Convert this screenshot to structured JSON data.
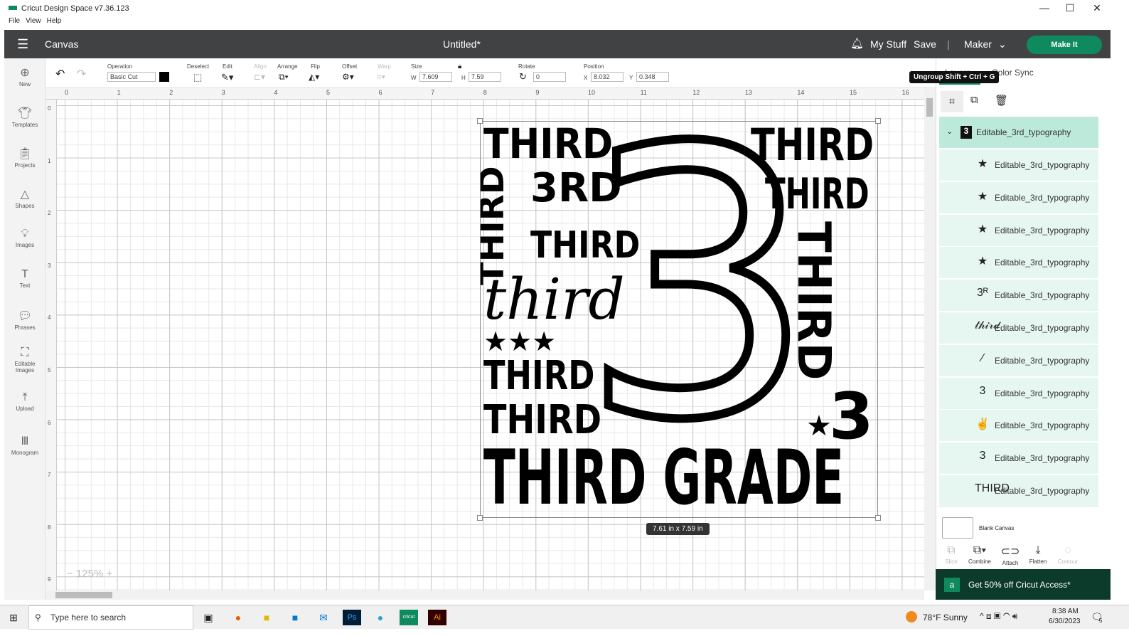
{
  "window": {
    "title": "Cricut Design Space  v7.36.123",
    "minimize": "—",
    "maximize": "☐",
    "close": "✕"
  },
  "menu": [
    "File",
    "View",
    "Help"
  ],
  "header": {
    "canvas_label": "Canvas",
    "doc_title": "Untitled*",
    "my_stuff": "My Stuff",
    "save": "Save",
    "separator": "|",
    "machine": "Maker",
    "make_it": "Make It"
  },
  "sidebar": [
    {
      "label": "New",
      "icon": "plus-circle"
    },
    {
      "label": "Templates",
      "icon": "shirt"
    },
    {
      "label": "Projects",
      "icon": "clipboard"
    },
    {
      "label": "Shapes",
      "icon": "shapes"
    },
    {
      "label": "Images",
      "icon": "lightbulb"
    },
    {
      "label": "Text",
      "icon": "T"
    },
    {
      "label": "Phrases",
      "icon": "speech"
    },
    {
      "label": "Editable Images",
      "icon": "edit-image"
    },
    {
      "label": "Upload",
      "icon": "upload"
    },
    {
      "label": "Monogram",
      "icon": "monogram"
    }
  ],
  "toolbar": {
    "operation_label": "Operation",
    "operation_value": "Basic Cut",
    "color": "#000000",
    "deselect": "Deselect",
    "edit": "Edit",
    "align": "Align",
    "arrange": "Arrange",
    "flip": "Flip",
    "offset": "Offset",
    "warp": "Warp",
    "size": "Size",
    "w_label": "W",
    "w": "7.609",
    "h_label": "H",
    "h": "7.59",
    "rotate": "Rotate",
    "rotate_value": "0",
    "position": "Position",
    "x_label": "X",
    "x": "8.032",
    "y_label": "Y",
    "y": "0.348"
  },
  "ruler": {
    "top": [
      "0",
      "1",
      "2",
      "3",
      "4",
      "5",
      "6",
      "7",
      "8",
      "9",
      "10",
      "11",
      "12",
      "13",
      "14",
      "15",
      "16"
    ],
    "left": [
      "0",
      "1",
      "2",
      "3",
      "4",
      "5",
      "6",
      "7",
      "8",
      "9"
    ]
  },
  "zoom": {
    "level": "125%",
    "minus": "−",
    "plus": "+"
  },
  "design": {
    "words": [
      "THIRD",
      "3RD",
      "THIRD",
      "third",
      "★★★",
      "THIRD",
      "THIRD",
      "THIRD GRADE",
      "THIRD",
      "THIRD",
      "THIRD",
      "THIRD",
      "3",
      "★"
    ],
    "size_badge": "7.61  in x 7.59  in"
  },
  "panel": {
    "tooltip": "Ungroup Shift + Ctrl + G",
    "tabs": [
      "Layers",
      "Color Sync"
    ],
    "group_name": "Editable_3rd_typography",
    "layers": [
      {
        "icon": "★",
        "name": "Editable_3rd_typography"
      },
      {
        "icon": "★",
        "name": "Editable_3rd_typography"
      },
      {
        "icon": "★",
        "name": "Editable_3rd_typography"
      },
      {
        "icon": "★",
        "name": "Editable_3rd_typography"
      },
      {
        "icon": "3ᴿ",
        "name": "Editable_3rd_typography"
      },
      {
        "icon": "𝓉𝒽𝒾𝓇𝒹",
        "name": "Editable_3rd_typography"
      },
      {
        "icon": "⁄",
        "name": "Editable_3rd_typography"
      },
      {
        "icon": "3",
        "name": "Editable_3rd_typography"
      },
      {
        "icon": "✌",
        "name": "Editable_3rd_typography"
      },
      {
        "icon": "3",
        "name": "Editable_3rd_typography"
      },
      {
        "icon": "THIRD",
        "name": "Editable_3rd_typography"
      }
    ],
    "blank_canvas": "Blank Canvas",
    "tools": [
      "Slice",
      "Combine",
      "Attach",
      "Flatten",
      "Contour"
    ],
    "promo": "Get 50% off Cricut Access*",
    "accent": "#0f8a5f"
  },
  "taskbar": {
    "search_placeholder": "Type here to search",
    "weather": "78°F  Sunny",
    "time": "8:38 AM",
    "date": "6/30/2023",
    "notifications": "5"
  }
}
